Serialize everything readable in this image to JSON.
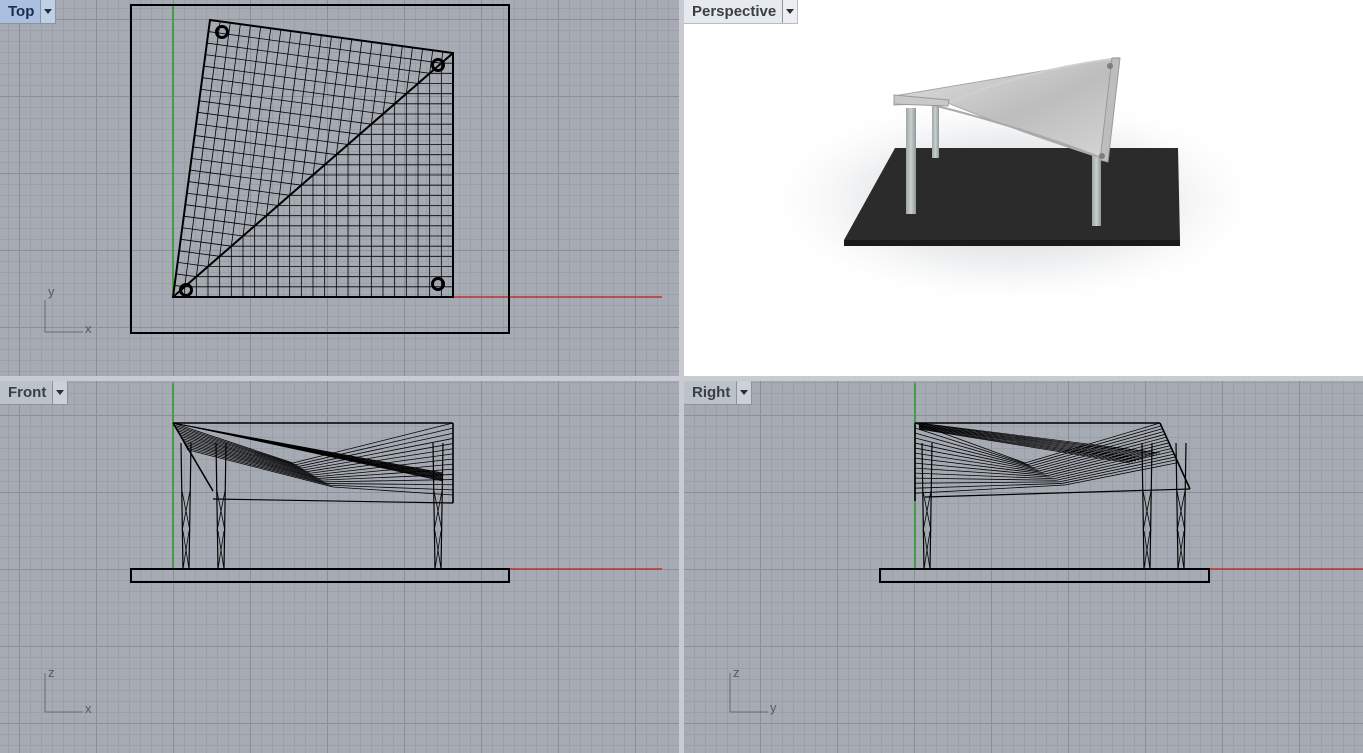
{
  "viewports": {
    "top": {
      "title": "Top",
      "axis_h": "x",
      "axis_v": "y"
    },
    "perspective": {
      "title": "Perspective"
    },
    "front": {
      "title": "Front",
      "axis_h": "x",
      "axis_v": "z"
    },
    "right": {
      "title": "Right",
      "axis_h": "y",
      "axis_v": "z"
    }
  },
  "colors": {
    "x_axis": "#c03030",
    "y_axis": "#2a9a2a",
    "wire": "#000000",
    "active_tab": "#a9c0e0"
  }
}
